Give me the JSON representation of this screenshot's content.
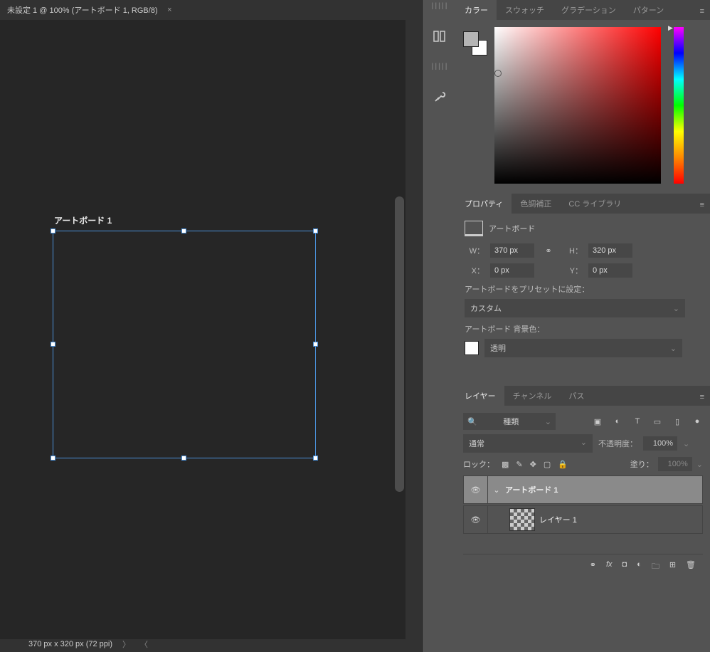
{
  "document": {
    "tab_title": "未設定 1 @ 100% (アートボード 1, RGB/8)",
    "artboard_label": "アートボード 1",
    "status_dims": "370 px x 320 px (72 ppi)"
  },
  "color_panel": {
    "tabs": [
      "カラー",
      "スウォッチ",
      "グラデーション",
      "パターン"
    ]
  },
  "properties_panel": {
    "tabs": [
      "プロパティ",
      "色調補正",
      "CC ライブラリ"
    ],
    "type_label": "アートボード",
    "W_label": "W：",
    "W_value": "370 px",
    "H_label": "H：",
    "H_value": "320 px",
    "X_label": "X：",
    "X_value": "0 px",
    "Y_label": "Y：",
    "Y_value": "0 px",
    "preset_label": "アートボードをプリセットに設定：",
    "preset_value": "カスタム",
    "bgcolor_label": "アートボード 背景色：",
    "bgcolor_value": "透明"
  },
  "layers_panel": {
    "tabs": [
      "レイヤー",
      "チャンネル",
      "パス"
    ],
    "filter_value": "種類",
    "blend_value": "通常",
    "opacity_label": "不透明度：",
    "opacity_value": "100%",
    "lock_label": "ロック：",
    "fill_label": "塗り：",
    "fill_value": "100%",
    "items": [
      {
        "name": "アートボード 1"
      },
      {
        "name": "レイヤー 1"
      }
    ]
  }
}
